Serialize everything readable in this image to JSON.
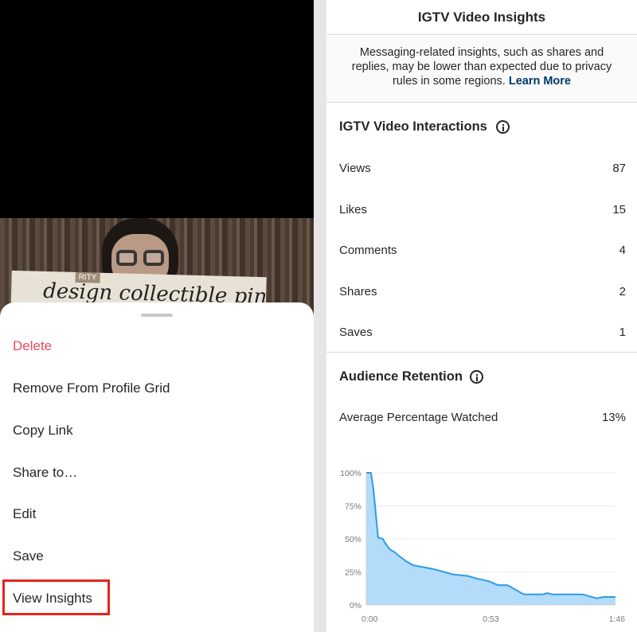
{
  "left_panel": {
    "video_overlay_text": "design collectible pins",
    "video_tag_text": "RITY",
    "menu": {
      "delete": "Delete",
      "remove_from_grid": "Remove From Profile Grid",
      "copy_link": "Copy Link",
      "share_to": "Share to…",
      "edit": "Edit",
      "save": "Save",
      "view_insights": "View Insights"
    },
    "highlight_color": "#e5251b",
    "delete_color": "#ed4956"
  },
  "right_panel": {
    "title": "IGTV Video Insights",
    "notice": {
      "text": "Messaging-related insights, such as shares and replies, may be lower than expected due to privacy rules in some regions.",
      "link": "Learn More"
    },
    "interactions": {
      "title": "IGTV Video Interactions",
      "icon": "info-icon",
      "rows": [
        {
          "label": "Views",
          "value": "87"
        },
        {
          "label": "Likes",
          "value": "15"
        },
        {
          "label": "Comments",
          "value": "4"
        },
        {
          "label": "Shares",
          "value": "2"
        },
        {
          "label": "Saves",
          "value": "1"
        }
      ]
    },
    "retention": {
      "title": "Audience Retention",
      "icon": "info-icon",
      "avg_label": "Average Percentage Watched",
      "avg_value": "13%"
    }
  },
  "chart_data": {
    "type": "area",
    "title": "",
    "xlabel": "",
    "ylabel": "",
    "x_ticks": [
      "0:00",
      "0:53",
      "1:46"
    ],
    "y_ticks": [
      "0%",
      "25%",
      "50%",
      "75%",
      "100%"
    ],
    "ylim": [
      0,
      100
    ],
    "xlim": [
      0,
      106
    ],
    "grid": true,
    "line_color": "#2d9be8",
    "fill_color": "#b3dcfb",
    "series": [
      {
        "x": [
          0,
          2,
          3,
          4,
          5,
          7,
          8,
          10,
          12,
          14,
          17,
          20,
          23,
          26,
          29,
          31,
          37,
          43,
          47,
          52,
          56,
          60,
          62,
          67,
          75,
          77,
          79,
          83,
          92,
          98,
          101,
          106
        ],
        "y": [
          100,
          100,
          88,
          70,
          51,
          50,
          47,
          42,
          40,
          37,
          33,
          30,
          29,
          28,
          27,
          26,
          23,
          22,
          20,
          18,
          15,
          15,
          13,
          8,
          8,
          9,
          8,
          8,
          8,
          5,
          6,
          6
        ]
      }
    ]
  }
}
